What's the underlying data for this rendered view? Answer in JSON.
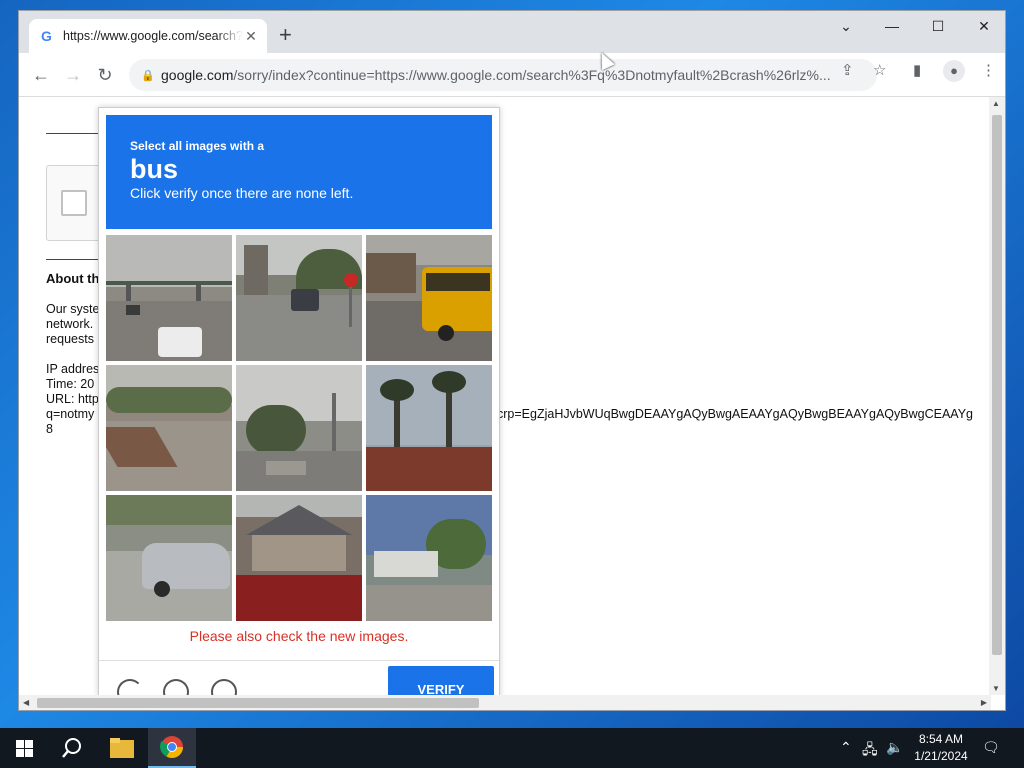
{
  "browser": {
    "tab_title": "https://www.google.com/search?q=notmyfault",
    "tab_favicon": "G",
    "url_host": "google.com",
    "url_rest": "/sorry/index?continue=https://www.google.com/search%3Fq%3Dnotmyfault%2Bcrash%26rlz%..."
  },
  "page": {
    "about_heading": "About th",
    "body_lines": "Our syste\nnetwork.\nrequests",
    "meta_lines": "IP addres\nTime: 20\nURL: http\nq=notmy\n8",
    "long_url_fragment": "crp=EgZjaHJvbWUqBwgDEAAYgAQyBwgAEAAYgAQyBwgBEAAYgAQyBwgCEAAYg"
  },
  "captcha": {
    "instruction_small": "Select all images with a",
    "target": "bus",
    "instruction_sub": "Click verify once there are none left.",
    "error_text": "Please also check the new images.",
    "verify_label": "VERIFY",
    "tiles": [
      {
        "name": "tile-highway-traffic-lights"
      },
      {
        "name": "tile-street-cars-stop-sign"
      },
      {
        "name": "tile-yellow-school-bus"
      },
      {
        "name": "tile-road-with-trees"
      },
      {
        "name": "tile-intersection-trees"
      },
      {
        "name": "tile-palm-trees-building"
      },
      {
        "name": "tile-silver-car-driveway"
      },
      {
        "name": "tile-house-red-flowers"
      },
      {
        "name": "tile-house-trees"
      }
    ]
  },
  "taskbar": {
    "time": "8:54 AM",
    "date": "1/21/2024"
  },
  "colors": {
    "captcha_blue": "#1a73e8",
    "error_red": "#d93025"
  }
}
